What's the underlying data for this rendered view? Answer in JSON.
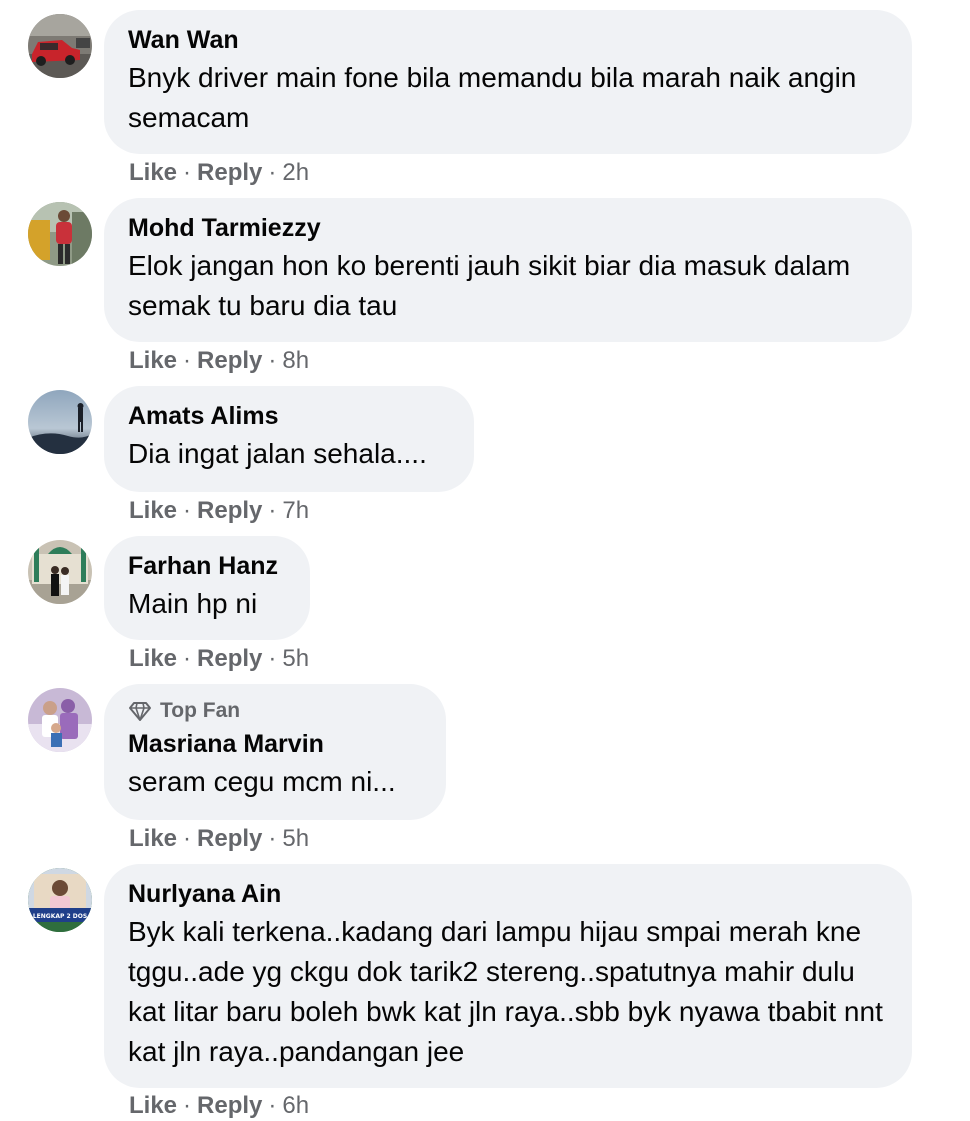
{
  "comments": [
    {
      "author": "Wan Wan",
      "text": "Bnyk driver main fone bila memandu bila marah naik angin semacam",
      "like": "Like",
      "reply": "Reply",
      "time": "2h",
      "avatar": "car-photo"
    },
    {
      "author": "Mohd Tarmiezzy",
      "text": "Elok jangan hon ko berenti jauh sikit biar dia masuk dalam semak tu baru dia tau",
      "like": "Like",
      "reply": "Reply",
      "time": "8h",
      "avatar": "person-photo"
    },
    {
      "author": "Amats Alims",
      "text": "Dia ingat jalan sehala....",
      "like": "Like",
      "reply": "Reply",
      "time": "7h",
      "avatar": "sky-silhouette-photo"
    },
    {
      "author": "Farhan Hanz",
      "text": "Main hp ni",
      "like": "Like",
      "reply": "Reply",
      "time": "5h",
      "avatar": "mosque-photo"
    },
    {
      "badge": "Top Fan",
      "badge_icon": "diamond-icon",
      "author": "Masriana Marvin",
      "text": "seram cegu mcm ni...",
      "like": "Like",
      "reply": "Reply",
      "time": "5h",
      "avatar": "family-photo"
    },
    {
      "author": "Nurlyana Ain",
      "text": "Byk kali terkena..kadang dari lampu hijau smpai merah kne tggu..ade yg ckgu dok tarik2 stereng..spatutnya mahir dulu kat litar baru boleh bwk kat jln raya..sbb byk nyawa tbabit nnt kat jln raya..pandangan jee",
      "like": "Like",
      "reply": "Reply",
      "time": "6h",
      "avatar": "vaccine-frame-photo",
      "avatar_text_1": "LENGKAP 2 DOS"
    }
  ],
  "colors": {
    "bubble": "#f0f2f5",
    "secondary_text": "#65676b",
    "primary_text": "#050505"
  }
}
